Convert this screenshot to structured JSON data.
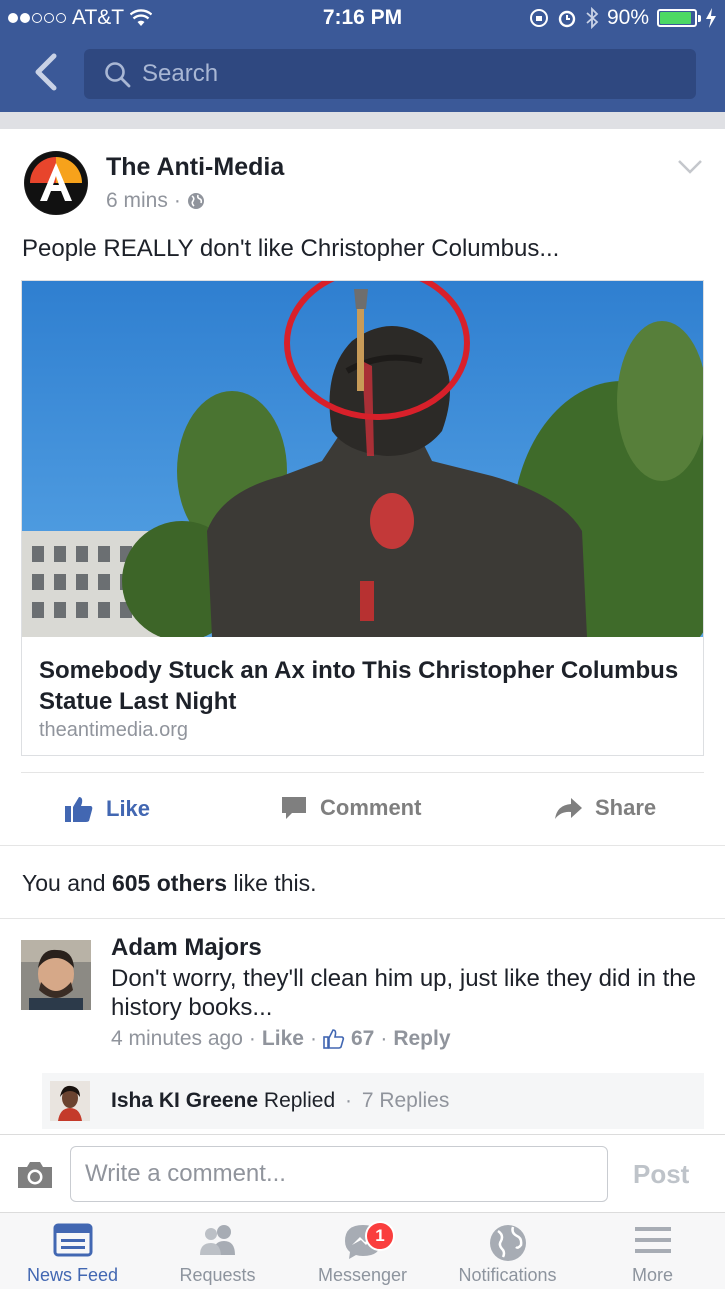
{
  "status_bar": {
    "carrier": "AT&T",
    "time": "7:16 PM",
    "battery": "90%",
    "battery_level": 0.9
  },
  "search": {
    "placeholder": "Search"
  },
  "post": {
    "page_name": "The Anti-Media",
    "time": "6 mins",
    "separator": "·",
    "text": "People REALLY don't like Christopher Columbus...",
    "link": {
      "title": "Somebody Stuck an Ax into This Christopher Columbus Statue Last Night",
      "domain": "theantimedia.org"
    },
    "actions": {
      "like": "Like",
      "comment": "Comment",
      "share": "Share"
    },
    "likes": {
      "prefix": "You and ",
      "count": "605 others",
      "suffix": " like this."
    }
  },
  "comment": {
    "author": "Adam Majors",
    "text": "Don't worry, they'll clean him up, just like they did in the history books...",
    "time": "4 minutes ago",
    "dot": "·",
    "like": "Like",
    "like_count": "67",
    "reply": "Reply",
    "replies": {
      "replier": "Isha KI Greene",
      "replied": "Replied",
      "dot": "·",
      "count": "7 Replies"
    }
  },
  "composer": {
    "placeholder": "Write a comment...",
    "post": "Post"
  },
  "tabs": [
    {
      "label": "News Feed",
      "icon": "news-feed-icon",
      "active": true
    },
    {
      "label": "Requests",
      "icon": "friends-icon"
    },
    {
      "label": "Messenger",
      "icon": "messenger-icon",
      "badge": "1"
    },
    {
      "label": "Notifications",
      "icon": "globe-icon"
    },
    {
      "label": "More",
      "icon": "menu-icon"
    }
  ],
  "colors": {
    "brand": "#3b5998",
    "link": "#4267b2",
    "badge": "#fa3e3e",
    "muted": "#90949c"
  }
}
